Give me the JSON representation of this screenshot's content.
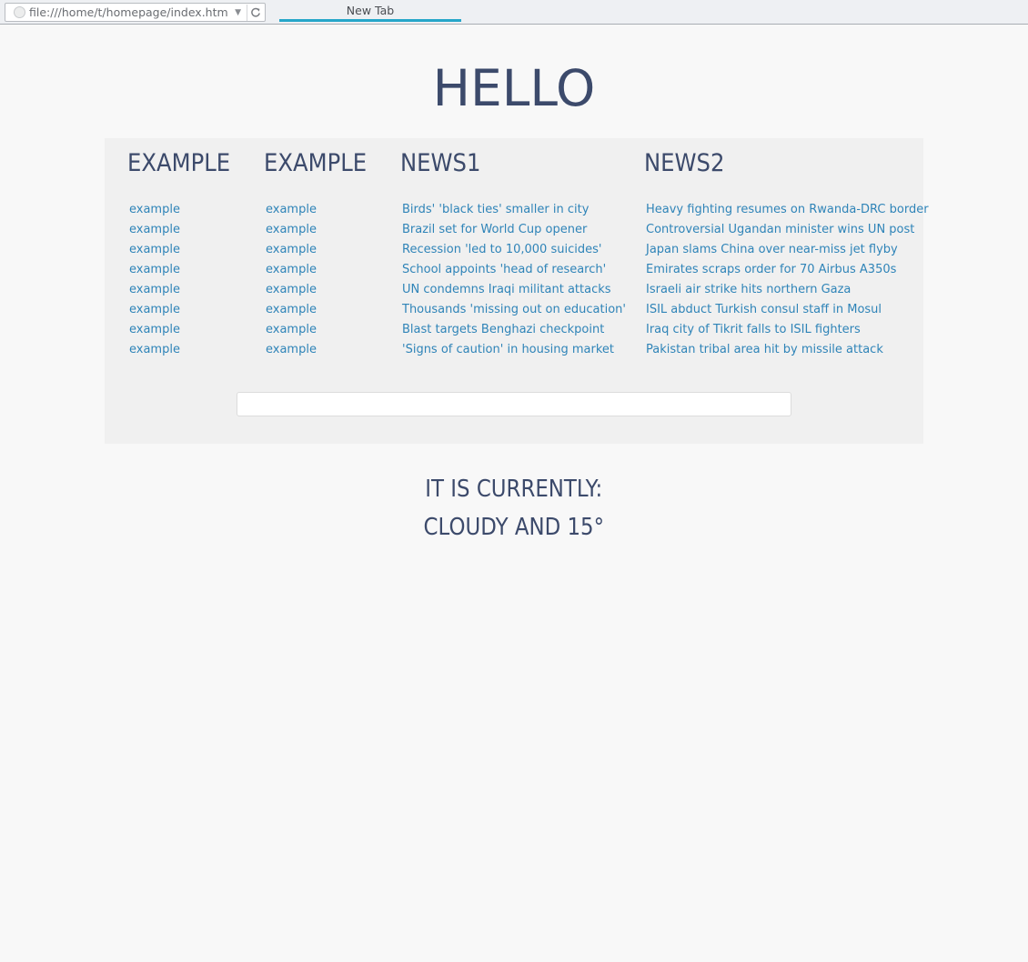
{
  "browser": {
    "url": "file:///home/t/homepage/index.htm",
    "tab_title": "New Tab"
  },
  "page": {
    "title": "HELLO",
    "columns": [
      {
        "heading": "EXAMPLE",
        "links": [
          "example",
          "example",
          "example",
          "example",
          "example",
          "example",
          "example",
          "example"
        ]
      },
      {
        "heading": "EXAMPLE",
        "links": [
          "example",
          "example",
          "example",
          "example",
          "example",
          "example",
          "example",
          "example"
        ]
      },
      {
        "heading": "NEWS1",
        "links": [
          "Birds' 'black ties' smaller in city",
          "Brazil set for World Cup opener",
          "Recession 'led to 10,000 suicides'",
          "School appoints 'head of research'",
          "UN condemns Iraqi militant attacks",
          "Thousands 'missing out on education'",
          "Blast targets Benghazi checkpoint",
          "'Signs of caution' in housing market"
        ]
      },
      {
        "heading": "NEWS2",
        "links": [
          "Heavy fighting resumes on Rwanda-DRC border",
          "Controversial Ugandan minister wins UN post",
          "Japan slams China over near-miss jet flyby",
          "Emirates scraps order for 70 Airbus A350s",
          "Israeli air strike hits northern Gaza",
          "ISIL abduct Turkish consul staff in Mosul",
          "Iraq city of Tikrit falls to ISIL fighters",
          "Pakistan tribal area hit by missile attack"
        ]
      }
    ],
    "search_value": "",
    "weather": {
      "line1": "IT IS CURRENTLY:",
      "line2": "CLOUDY AND 15°"
    }
  },
  "colors": {
    "heading": "#3c4a6b",
    "link": "#2f84b8",
    "panel_bg": "#f0f0f0",
    "tab_accent": "#26a6c9"
  },
  "icons": {
    "url_icon": "globe-icon",
    "dropdown": "caret-down-icon",
    "reload": "reload-icon"
  }
}
